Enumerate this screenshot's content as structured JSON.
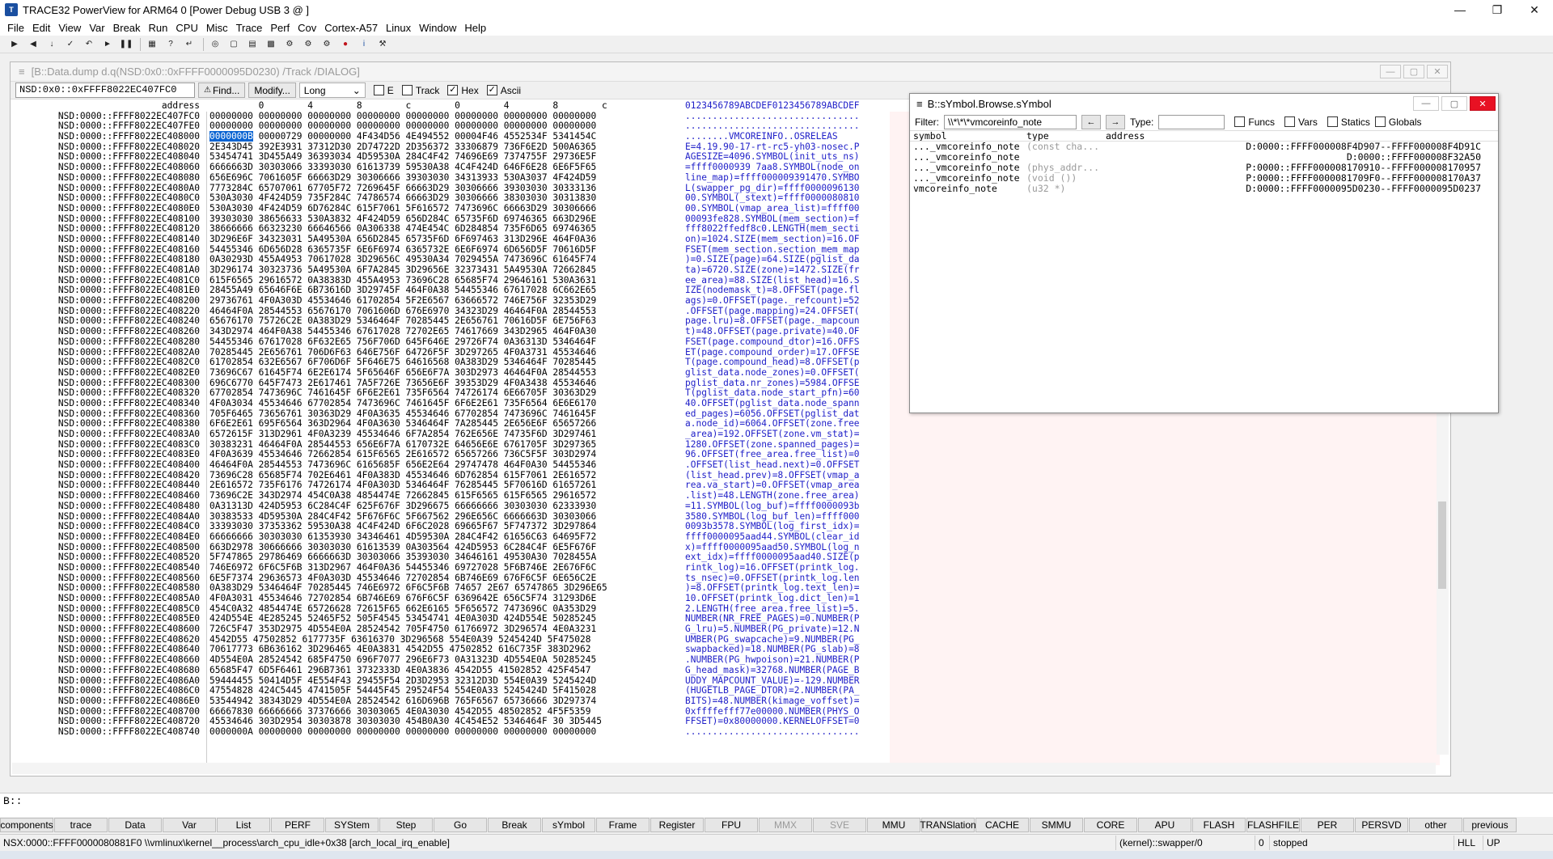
{
  "window": {
    "title": "TRACE32 PowerView for ARM64 0 [Power Debug USB 3 @ ]"
  },
  "menu": [
    "File",
    "Edit",
    "View",
    "Var",
    "Break",
    "Run",
    "CPU",
    "Misc",
    "Trace",
    "Perf",
    "Cov",
    "Cortex-A57",
    "Linux",
    "Window",
    "Help"
  ],
  "dump": {
    "title": "[B::Data.dump d.q(NSD:0x0::0xFFFF0000095D0230) /Track /DIALOG]",
    "address_value": "NSD:0x0::0xFFFF8022EC407FC0",
    "find_label": "Find...",
    "modify_label": "Modify...",
    "width_value": "Long",
    "cb_e": "E",
    "cb_track": "Track",
    "cb_hex": "Hex",
    "cb_ascii": "Ascii",
    "hdr_addr": "address",
    "hdr_hex": "         0        4        8        c        0        4        8        c",
    "hdr_asc": "0123456789ABCDEF0123456789ABCDEF",
    "rows": [
      [
        "NSD:0000::FFFF8022EC407FC0",
        "00000000 00000000 00000000 00000000 00000000 00000000 00000000 00000000",
        "................................"
      ],
      [
        "NSD:0000::FFFF8022EC407FE0",
        "00000000 00000000 00000000 00000000 00000000 00000000 00000000 00000000",
        "................................"
      ],
      [
        "NSD:0000::FFFF8022EC408000",
        "0000000B 00000729 00000000 4F434D56 4E494552 00004F46 4552534F 5341454C",
        "........VMCOREINFO..OSRELEAS"
      ],
      [
        "NSD:0000::FFFF8022EC408020",
        "2E343D45 392E3931 37312D30 2D74722D 2D356372 33306879 736F6E2D 500A6365",
        "E=4.19.90-17-rt-rc5-yh03-nosec.P"
      ],
      [
        "NSD:0000::FFFF8022EC408040",
        "53454741 3D455A49 36393034 4D59530A 284C4F42 74696E69 7374755F 29736E5F",
        "AGESIZE=4096.SYMBOL(init_uts_ns)"
      ],
      [
        "NSD:0000::FFFF8022EC408060",
        "6666663D 30303066 33393030 61613739 59530A38 4C4F424D 646F6E28 6E6F5F65",
        "=ffff0000939 7aa8.SYMBOL(node_on"
      ],
      [
        "NSD:0000::FFFF8022EC408080",
        "656E696C 7061605F 66663D29 30306666 39303030 34313933 530A3037 4F424D59",
        "line_map)=ffff000009391470.SYMBO"
      ],
      [
        "NSD:0000::FFFF8022EC4080A0",
        "7773284C 65707061 67705F72 7269645F 66663D29 30306666 39303030 30333136",
        "L(swapper_pg_dir)=ffff0000096130"
      ],
      [
        "NSD:0000::FFFF8022EC4080C0",
        "530A3030 4F424D59 735F284C 74786574 66663D29 30306666 38303030 30313830",
        "00.SYMBOL(_stext)=ffff0000080810"
      ],
      [
        "NSD:0000::FFFF8022EC4080E0",
        "530A3030 4F424D59 6D76284C 615F7061 5F616572 7473696C 66663D29 30306666",
        "00.SYMBOL(vmap_area_list)=ffff00"
      ],
      [
        "NSD:0000::FFFF8022EC408100",
        "39303030 38656633 530A3832 4F424D59 656D284C 65735F6D 69746365 663D296E",
        "00093fe828.SYMBOL(mem_section)=f"
      ],
      [
        "NSD:0000::FFFF8022EC408120",
        "38666666 66323230 66646566 0A306338 474E454C 6D284854 735F6D65 69746365",
        "fff8022ffedf8c0.LENGTH(mem_secti"
      ],
      [
        "NSD:0000::FFFF8022EC408140",
        "3D296E6F 34323031 5A49530A 656D2845 65735F6D 6F697463 313D296E 464F0A36",
        "on)=1024.SIZE(mem_section)=16.OF"
      ],
      [
        "NSD:0000::FFFF8022EC408160",
        "54455346 6D656D28 6365735F 6E6F6974 6365732E 6E6F6974 6D656D5F 70616D5F",
        "FSET(mem_section.section_mem_map"
      ],
      [
        "NSD:0000::FFFF8022EC408180",
        "0A30293D 455A4953 70617028 3D29656C 49530A34 7029455A 7473696C 61645F74",
        ")=0.SIZE(page)=64.SIZE(pglist_da"
      ],
      [
        "NSD:0000::FFFF8022EC4081A0",
        "3D296174 30323736 5A49530A 6F7A2845 3D29656E 32373431 5A49530A 72662845",
        "ta)=6720.SIZE(zone)=1472.SIZE(fr"
      ],
      [
        "NSD:0000::FFFF8022EC4081C0",
        "615F6565 29616572 0A38383D 455A4953 73696C28 65685F74 29646161 530A3631",
        "ee_area)=88.SIZE(list_head)=16.S"
      ],
      [
        "NSD:0000::FFFF8022EC4081E0",
        "28455A49 65646F6E 6B73616D 3D29745F 464F0A38 54455346 67617028 6C662E65",
        "IZE(nodemask_t)=8.OFFSET(page.fl"
      ],
      [
        "NSD:0000::FFFF8022EC408200",
        "29736761 4F0A303D 45534646 61702854 5F2E6567 63666572 746E756F 32353D29",
        "ags)=0.OFFSET(page._refcount)=52"
      ],
      [
        "NSD:0000::FFFF8022EC408220",
        "46464F0A 28544553 65676170 7061606D 676E6970 34323D29 46464F0A 28544553",
        ".OFFSET(page.mapping)=24.OFFSET("
      ],
      [
        "NSD:0000::FFFF8022EC408240",
        "65676170 75726C2E 0A383D29 5346464F 70285445 2E656761 70616D5F 6E756F63",
        "page.lru)=8.OFFSET(page._mapcoun"
      ],
      [
        "NSD:0000::FFFF8022EC408260",
        "343D2974 464F0A38 54455346 67617028 72702E65 74617669 343D2965 464F0A30",
        "t)=48.OFFSET(page.private)=40.OF"
      ],
      [
        "NSD:0000::FFFF8022EC408280",
        "54455346 67617028 6F632E65 756F706D 645F646E 29726F74 0A36313D 5346464F",
        "FSET(page.compound_dtor)=16.OFFS"
      ],
      [
        "NSD:0000::FFFF8022EC4082A0",
        "70285445 2E656761 706D6F63 646E756F 64726F5F 3D297265 4F0A3731 45534646",
        "ET(page.compound_order)=17.OFFSE"
      ],
      [
        "NSD:0000::FFFF8022EC4082C0",
        "61702854 632E6567 6F706D6F 5F646E75 64616568 0A383D29 5346464F 70285445",
        "T(page.compound_head)=8.OFFSET(p"
      ],
      [
        "NSD:0000::FFFF8022EC4082E0",
        "73696C67 61645F74 6E2E6174 5F65646F 656E6F7A 303D2973 46464F0A 28544553",
        "glist_data.node_zones)=0.OFFSET("
      ],
      [
        "NSD:0000::FFFF8022EC408300",
        "696C6770 645F7473 2E617461 7A5F726E 73656E6F 39353D29 4F0A3438 45534646",
        "pglist_data.nr_zones)=5984.OFFSE"
      ],
      [
        "NSD:0000::FFFF8022EC408320",
        "67702854 7473696C 7461645F 6F6E2E61 735F6564 74726174 6E66705F 30363D29",
        "T(pglist_data.node_start_pfn)=60"
      ],
      [
        "NSD:0000::FFFF8022EC408340",
        "4F0A3034 45534646 67702854 7473696C 7461645F 6F6E2E61 735F6564 6E6E6170",
        "40.OFFSET(pglist_data.node_spann"
      ],
      [
        "NSD:0000::FFFF8022EC408360",
        "705F6465 73656761 30363D29 4F0A3635 45534646 67702854 7473696C 7461645F",
        "ed_pages)=6056.OFFSET(pglist_dat"
      ],
      [
        "NSD:0000::FFFF8022EC408380",
        "6F6E2E61 695F6564 363D2964 4F0A3630 5346464F 7A285445 2E656E6F 65657266",
        "a.node_id)=6064.OFFSET(zone.free"
      ],
      [
        "NSD:0000::FFFF8022EC4083A0",
        "6572615F 313D2961 4F0A3239 45534646 6F7A2854 762E656E 74735F6D 3D297461",
        "_area)=192.OFFSET(zone.vm_stat)="
      ],
      [
        "NSD:0000::FFFF8022EC4083C0",
        "30383231 46464F0A 28544553 656E6F7A 6170732E 64656E6E 6761705F 3D297365",
        "1280.OFFSET(zone.spanned_pages)="
      ],
      [
        "NSD:0000::FFFF8022EC4083E0",
        "4F0A3639 45534646 72662854 615F6565 2E616572 65657266 736C5F5F 303D2974",
        "96.OFFSET(free_area.free_list)=0"
      ],
      [
        "NSD:0000::FFFF8022EC408400",
        "46464F0A 28544553 7473696C 6165685F 656E2E64 29747478 464F0A30 54455346",
        ".OFFSET(list_head.next)=0.OFFSET"
      ],
      [
        "NSD:0000::FFFF8022EC408420",
        "73696C28 65685F74 702E6461 4F0A383D 45534646 6D762854 615F7061 2E616572",
        "(list_head.prev)=8.OFFSET(vmap_a"
      ],
      [
        "NSD:0000::FFFF8022EC408440",
        "2E616572 735F6176 74726174 4F0A303D 5346464F 76285445 5F70616D 61657261",
        "rea.va_start)=0.OFFSET(vmap_area"
      ],
      [
        "NSD:0000::FFFF8022EC408460",
        "73696C2E 343D2974 454C0A38 4854474E 72662845 615F6565 615F6565 29616572",
        ".list)=48.LENGTH(zone.free_area)"
      ],
      [
        "NSD:0000::FFFF8022EC408480",
        "0A31313D 424D5953 6C284C4F 625F676F 3D296675 66666666 30303030 62333930",
        "=11.SYMBOL(log_buf)=ffff0000093b"
      ],
      [
        "NSD:0000::FFFF8022EC4084A0",
        "30383533 4D59530A 284C4F42 5F676F6C 5F667562 296E656C 6666663D 30303066",
        "3580.SYMBOL(log_buf_len)=ffff000"
      ],
      [
        "NSD:0000::FFFF8022EC4084C0",
        "33393030 37353362 59530A38 4C4F424D 6F6C2028 69665F67 5F747372 3D297864",
        "0093b3578.SYMBOL(log_first_idx)="
      ],
      [
        "NSD:0000::FFFF8022EC4084E0",
        "66666666 30303030 61353930 34346461 4D59530A 284C4F42 61656C63 64695F72",
        "ffff0000095aad44.SYMBOL(clear_id"
      ],
      [
        "NSD:0000::FFFF8022EC408500",
        "663D2978 30666666 30303030 61613539 0A303564 424D5953 6C284C4F 6E5F676F",
        "x)=ffff0000095aad50.SYMBOL(log_n"
      ],
      [
        "NSD:0000::FFFF8022EC408520",
        "5F747865 29786469 6666663D 30303066 35393030 34646161 49530A30 7028455A",
        "ext_idx)=ffff0000095aad40.SIZE(p"
      ],
      [
        "NSD:0000::FFFF8022EC408540",
        "746E6972 6F6C5F6B 313D2967 464F0A36 54455346 69727028 5F6B746E 2E676F6C",
        "rintk_log)=16.OFFSET(printk_log."
      ],
      [
        "NSD:0000::FFFF8022EC408560",
        "6E5F7374 29636573 4F0A303D 45534646 72702854 6B746E69 676F6C5F 6E656C2E",
        "ts_nsec)=0.OFFSET(printk_log.len"
      ],
      [
        "NSD:0000::FFFF8022EC408580",
        "0A383D29 5346464F 70285445 746E6972 6F6C5F6B 74657 2E67 65747865 3D296E65",
        ")=8.OFFSET(printk_log.text_len)="
      ],
      [
        "NSD:0000::FFFF8022EC4085A0",
        "4F0A3031 45534646 72702854 6B746E69 676F6C5F 6369642E 656C5F74 31293D6E",
        "10.OFFSET(printk_log.dict_len)=1"
      ],
      [
        "NSD:0000::FFFF8022EC4085C0",
        "454C0A32 4854474E 65726628 72615F65 662E6165 5F656572 7473696C 0A353D29",
        "2.LENGTH(free_area.free_list)=5."
      ],
      [
        "NSD:0000::FFFF8022EC4085E0",
        "424D554E 4E285245 52465F52 505F4545 53454741 4E0A303D 424D554E 50285245",
        "NUMBER(NR_FREE_PAGES)=0.NUMBER(P"
      ],
      [
        "NSD:0000::FFFF8022EC408600",
        "726C5F47 353D2975 4D554E0A 28524542 705F4750 61766972 3D296574 4E0A3231",
        "G_lru)=5.NUMBER(PG_private)=12.N"
      ],
      [
        "NSD:0000::FFFF8022EC408620",
        "4542D55 47502852 6177735F 63616370 3D296568 554E0A39 5245424D 5F475028",
        "UMBER(PG_swapcache)=9.NUMBER(PG_"
      ],
      [
        "NSD:0000::FFFF8022EC408640",
        "70617773 6B636162 3D296465 4E0A3831 4542D55 47502852 616C735F 383D2962",
        "swapbacked)=18.NUMBER(PG_slab)=8"
      ],
      [
        "NSD:0000::FFFF8022EC408660",
        "4D554E0A 28524542 685F4750 696F7077 296E6F73 0A31323D 4D554E0A 50285245",
        ".NUMBER(PG_hwpoison)=21.NUMBER(P"
      ],
      [
        "NSD:0000::FFFF8022EC408680",
        "65685F47 6D5F6461 296B7361 3732333D 4E0A3836 4542D55 41502852 425F4547",
        "G_head_mask)=32768.NUMBER(PAGE_B"
      ],
      [
        "NSD:0000::FFFF8022EC4086A0",
        "59444455 50414D5F 4E554F43 29455F54 2D3D2953 32312D3D 554E0A39 5245424D",
        "UDDY_MAPCOUNT_VALUE)=-129.NUMBER"
      ],
      [
        "NSD:0000::FFFF8022EC4086C0",
        "47554828 424C5445 4741505F 54445F45 29524F54 554E0A33 5245424D 5F415028",
        "(HUGETLB_PAGE_DTOR)=2.NUMBER(PA_"
      ],
      [
        "NSD:0000::FFFF8022EC4086E0",
        "53544942 38343D29 4D554E0A 28524542 616D696B 765F6567 65736666 3D297374",
        "BITS)=48.NUMBER(kimage_voffset)="
      ],
      [
        "NSD:0000::FFFF8022EC408700",
        "66667830 66666666 37376666 30303065 4E0A3030 4542D55 48502852 4F5F5359",
        "0xffffefff77e00000.NUMBER(PHYS_O"
      ],
      [
        "NSD:0000::FFFF8022EC408720",
        "45534646 303D2954 30303878 30303030 454B0A30 4C454E52 5346464F 30 3D5445",
        "FFSET)=0x80000000.KERNELOFFSET=0"
      ],
      [
        "NSD:0000::FFFF8022EC408740",
        "0000000A 00000000 00000000 00000000 00000000 00000000 00000000 00000000",
        "................................"
      ]
    ]
  },
  "symbol": {
    "title": "B::sYmbol.Browse.sYmbol",
    "filter_label": "Filter:",
    "filter_value": "\\\\*\\*\\*vmcoreinfo_note",
    "type_label": "Type:",
    "type_value": "",
    "cb_funcs": "Funcs",
    "cb_vars": "Vars",
    "cb_statics": "Statics",
    "cb_globals": "Globals",
    "hdr_symbol": "symbol",
    "hdr_type": "type",
    "hdr_address": "address",
    "rows": [
      [
        "..._vmcoreinfo_note",
        "(const cha...",
        "D:0000::FFFF000008F4D907--FFFF000008F4D91C"
      ],
      [
        "..._vmcoreinfo_note",
        "",
        "D:0000::FFFF000008F32A50"
      ],
      [
        "..._vmcoreinfo_note",
        "(phys_addr...",
        "P:0000::FFFF000008170910--FFFF000008170957"
      ],
      [
        "..._vmcoreinfo_note",
        "(void ())",
        "P:0000::FFFF0000081709F0--FFFF000008170A37"
      ],
      [
        "vmcoreinfo_note",
        "(u32 *)",
        "D:0000::FFFF0000095D0230--FFFF0000095D0237"
      ]
    ]
  },
  "cmdline": {
    "prompt": "B::"
  },
  "softkeys": [
    {
      "label": "components",
      "w": 66,
      "dis": false
    },
    {
      "label": "trace",
      "w": 66,
      "dis": false
    },
    {
      "label": "Data",
      "w": 66,
      "dis": false
    },
    {
      "label": "Var",
      "w": 66,
      "dis": false
    },
    {
      "label": "List",
      "w": 66,
      "dis": false
    },
    {
      "label": "PERF",
      "w": 66,
      "dis": false
    },
    {
      "label": "SYStem",
      "w": 66,
      "dis": false
    },
    {
      "label": "Step",
      "w": 66,
      "dis": false
    },
    {
      "label": "Go",
      "w": 66,
      "dis": false
    },
    {
      "label": "Break",
      "w": 66,
      "dis": false
    },
    {
      "label": "sYmbol",
      "w": 66,
      "dis": false
    },
    {
      "label": "Frame",
      "w": 66,
      "dis": false
    },
    {
      "label": "Register",
      "w": 66,
      "dis": false
    },
    {
      "label": "FPU",
      "w": 66,
      "dis": false
    },
    {
      "label": "MMX",
      "w": 66,
      "dis": true
    },
    {
      "label": "SVE",
      "w": 66,
      "dis": true
    },
    {
      "label": "MMU",
      "w": 66,
      "dis": false
    },
    {
      "label": "TRANSlation",
      "w": 66,
      "dis": false
    },
    {
      "label": "CACHE",
      "w": 66,
      "dis": false
    },
    {
      "label": "SMMU",
      "w": 66,
      "dis": false
    },
    {
      "label": "CORE",
      "w": 66,
      "dis": false
    },
    {
      "label": "APU",
      "w": 66,
      "dis": false
    },
    {
      "label": "FLASH",
      "w": 66,
      "dis": false
    },
    {
      "label": "FLASHFILE",
      "w": 66,
      "dis": false
    },
    {
      "label": "PER",
      "w": 66,
      "dis": false
    },
    {
      "label": "PERSVD",
      "w": 66,
      "dis": false
    },
    {
      "label": "other",
      "w": 66,
      "dis": false
    },
    {
      "label": "previous",
      "w": 66,
      "dis": false
    }
  ],
  "status": {
    "location": "NSX:0000::FFFF0000080881F0 \\\\vmlinux\\kernel__process\\arch_cpu_idle+0x38  [arch_local_irq_enable]",
    "task": "(kernel)::swapper/0",
    "core": "0",
    "state": "stopped",
    "mode": "HLL",
    "dir": "UP"
  },
  "colors": {
    "ascii": "#1e1ec8",
    "pink_bg": "#fff3f3",
    "highlight": "#0a64d2",
    "close": "#e81123"
  }
}
